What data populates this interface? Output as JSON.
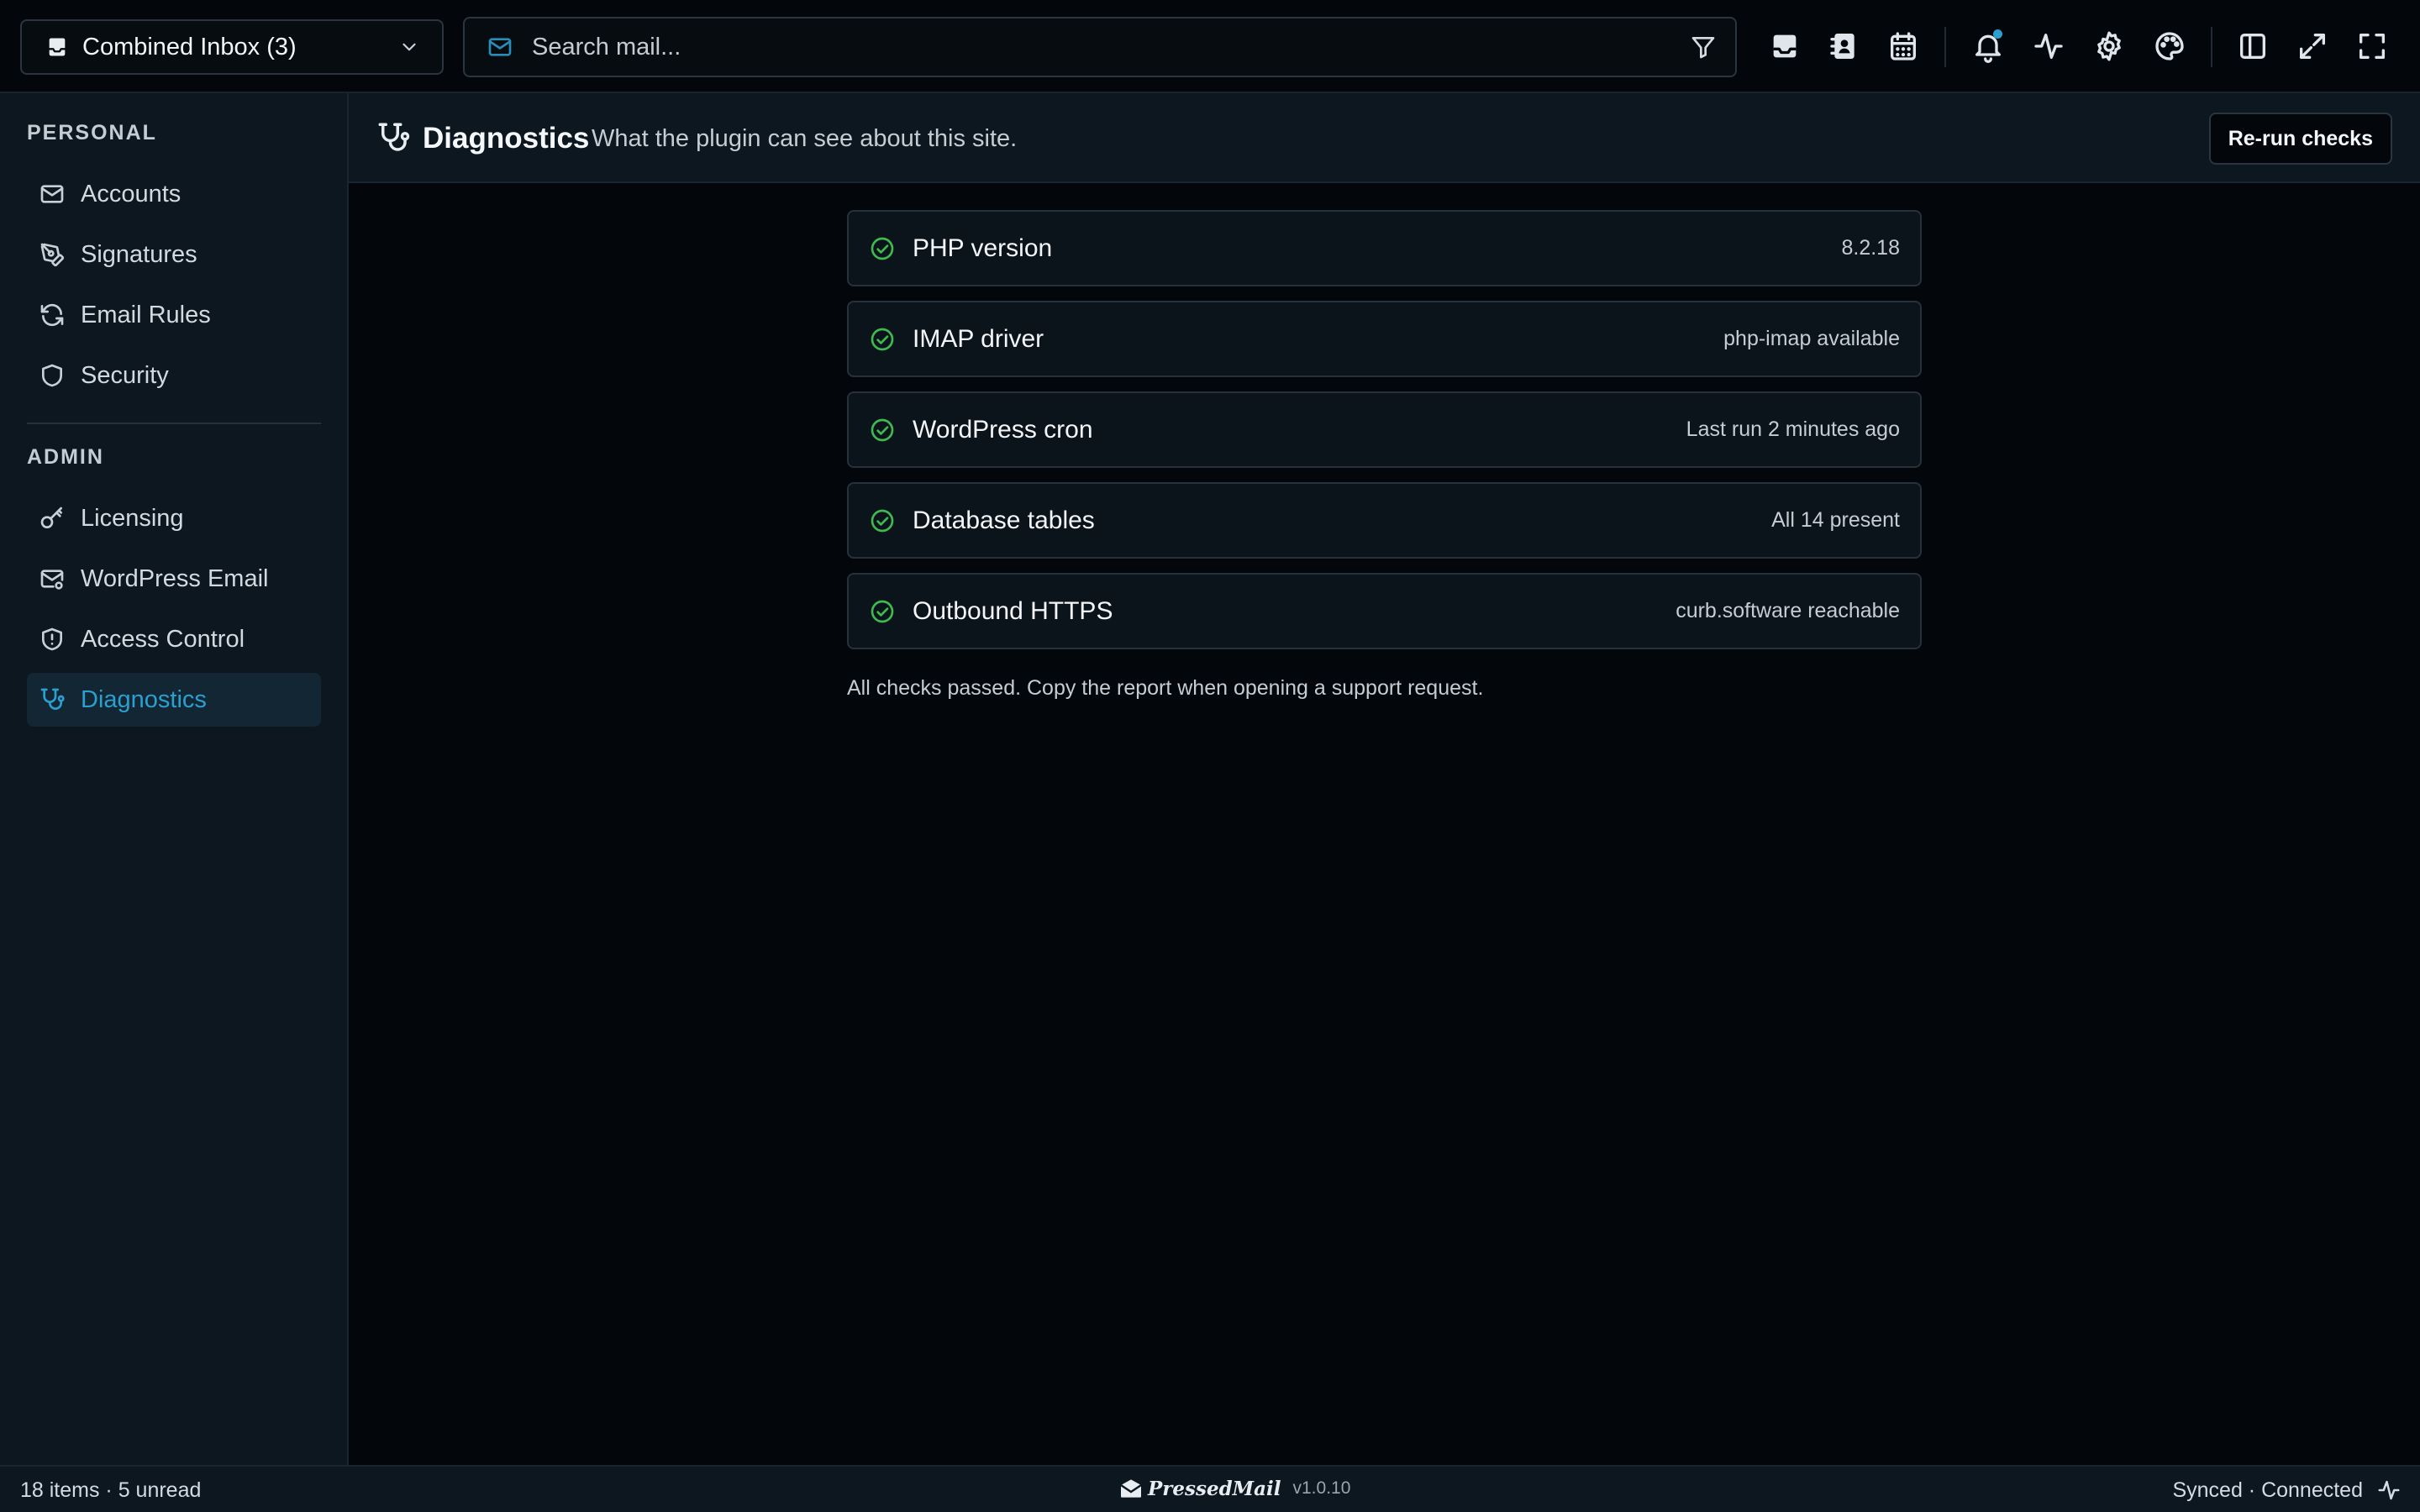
{
  "topbar": {
    "inbox_selector": {
      "label": "Combined Inbox (3)",
      "icon": "inbox-icon"
    },
    "search": {
      "placeholder": "Search mail...",
      "value": ""
    },
    "icons": [
      "inbox-icon",
      "contacts-icon",
      "calendar-icon",
      "bell-icon",
      "activity-icon",
      "gear-icon",
      "palette-icon",
      "sidebar-toggle-icon",
      "expand-icon",
      "fullscreen-icon"
    ],
    "notification_color": "#2a9fd0"
  },
  "sidebar": {
    "personal_title": "PERSONAL",
    "personal_items": [
      {
        "label": "Accounts",
        "icon": "mail-icon"
      },
      {
        "label": "Signatures",
        "icon": "pen-tool-icon"
      },
      {
        "label": "Email Rules",
        "icon": "refresh-icon"
      },
      {
        "label": "Security",
        "icon": "shield-icon"
      }
    ],
    "admin_title": "ADMIN",
    "admin_items": [
      {
        "label": "Licensing",
        "icon": "key-icon"
      },
      {
        "label": "WordPress Email",
        "icon": "mail-cog-icon"
      },
      {
        "label": "Access Control",
        "icon": "shield-alert-icon"
      },
      {
        "label": "Diagnostics",
        "icon": "stethoscope-icon",
        "active": true
      }
    ]
  },
  "page": {
    "title": "Diagnostics",
    "subtitle": "What the plugin can see about this site.",
    "rerun_label": "Re-run checks",
    "checks": [
      {
        "name": "PHP version",
        "value": "8.2.18",
        "status": "ok"
      },
      {
        "name": "IMAP driver",
        "value": "php-imap available",
        "status": "ok"
      },
      {
        "name": "WordPress cron",
        "value": "Last run 2 minutes ago",
        "status": "ok"
      },
      {
        "name": "Database tables",
        "value": "All 14 present",
        "status": "ok"
      },
      {
        "name": "Outbound HTTPS",
        "value": "curb.software reachable",
        "status": "ok"
      }
    ],
    "summary": "All checks passed. Copy the report when opening a support request."
  },
  "status_bar": {
    "items_text": "18 items · 5 unread",
    "brand": "PressedMail",
    "version": "v1.0.10",
    "connection": "Synced · Connected"
  },
  "colors": {
    "accent": "#2a9fd0",
    "success": "#3fb950",
    "background": "#03070b",
    "panel": "#0d1720"
  }
}
